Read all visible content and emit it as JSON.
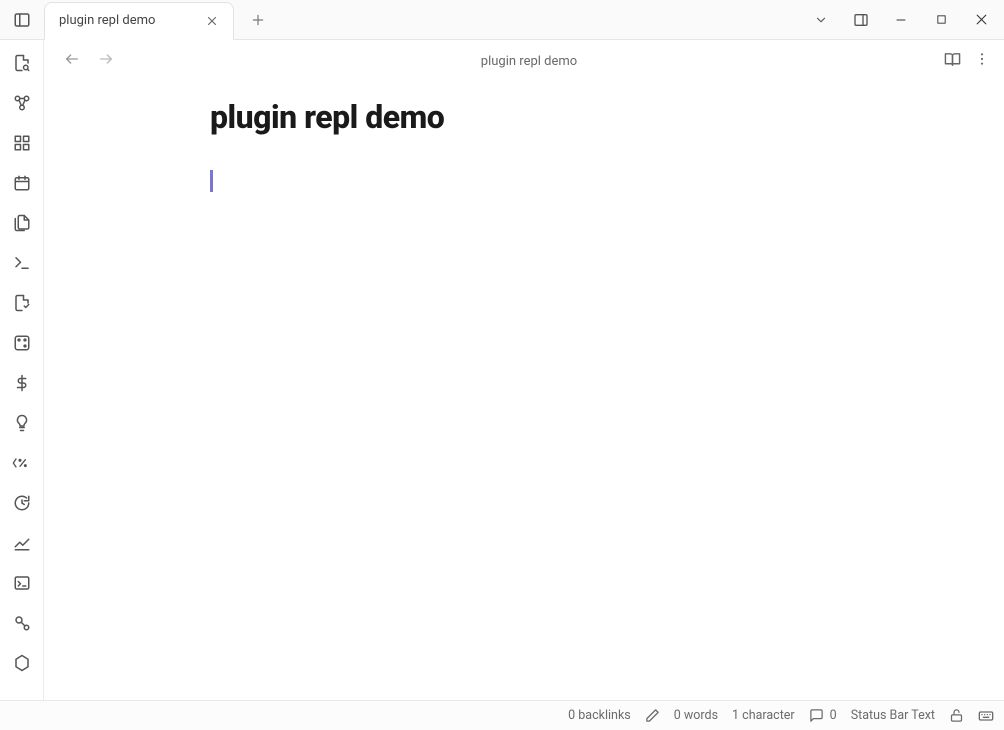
{
  "tab": {
    "title": "plugin repl demo"
  },
  "note": {
    "path": "plugin repl demo",
    "title": "plugin repl demo"
  },
  "ribbon": {
    "items": [
      "quick-switcher",
      "graph-view",
      "canvas",
      "daily-note",
      "templates",
      "command-palette",
      "plugins",
      "random-note",
      "currency",
      "lightbulb",
      "templater",
      "sync",
      "stats",
      "terminal",
      "automation",
      "settings-alt"
    ]
  },
  "status": {
    "backlinks": "0 backlinks",
    "words": "0 words",
    "characters": "1 character",
    "comments": "0",
    "custom": "Status Bar Text"
  }
}
